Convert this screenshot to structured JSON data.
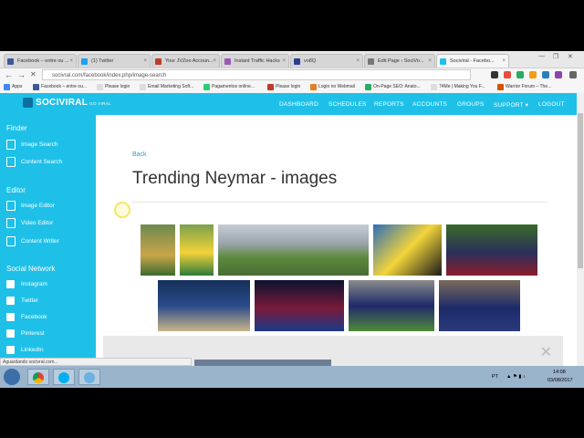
{
  "browser": {
    "tabs": [
      {
        "title": "Facebook – entre ou ...",
        "color": "#3b5998"
      },
      {
        "title": "(1) Twitter",
        "color": "#1da1f2"
      },
      {
        "title": "Your JVZoo Accoun...",
        "color": "#c0392b"
      },
      {
        "title": "Instant Traffic Hacks",
        "color": "#9b59b6"
      },
      {
        "title": "vo8Q",
        "color": "#2c3e90"
      },
      {
        "title": "Edit Page ‹ SociVo...",
        "color": "#777777"
      },
      {
        "title": "Sociviral - Facebo...",
        "color": "#1ec0e8"
      }
    ],
    "window_controls": [
      "—",
      "❐",
      "✕"
    ],
    "back_glyph": "←",
    "forward_glyph": "→",
    "reload_glyph": "✕",
    "url": "socivral.com/facebook/index.php/image-search",
    "bookmarks": [
      "Apps",
      "Facebook – entre ou...",
      "Please login",
      "Email Marketing Soft...",
      "Pagamentos online...",
      "Please login",
      "Login no Webmail",
      "On-Page SEO: Anato...",
      "74Me | Making You F...",
      "Warrior Forum – The..."
    ]
  },
  "app": {
    "logo_text": "SOCIVIRAL",
    "logo_sub": "GO VIRAL",
    "nav": [
      "DASHBOARD",
      "SCHEDULES",
      "REPORTS",
      "ACCOUNTS",
      "GROUPS",
      "SUPPORT ▾",
      "LOGOUT"
    ]
  },
  "sidebar": {
    "sections": [
      {
        "title": "Finder",
        "items": [
          "Image Search",
          "Content Search"
        ]
      },
      {
        "title": "Editor",
        "items": [
          "Image Editor",
          "Video Editor",
          "Content Writer"
        ]
      },
      {
        "title": "Social Network",
        "items": [
          "Instagram",
          "Twitter",
          "Facebook",
          "Pinterest",
          "LinkedIn"
        ]
      }
    ]
  },
  "main": {
    "back_link": "Back",
    "title": "Trending Neymar - images",
    "overlay_close": "✕"
  },
  "status_bar": "Aguardando socivral.com...",
  "taskbar": {
    "lang": "PT",
    "time": "14:08",
    "date": "03/08/2017"
  },
  "colors": {
    "accent": "#1ec0e8",
    "link": "#3399cc"
  }
}
